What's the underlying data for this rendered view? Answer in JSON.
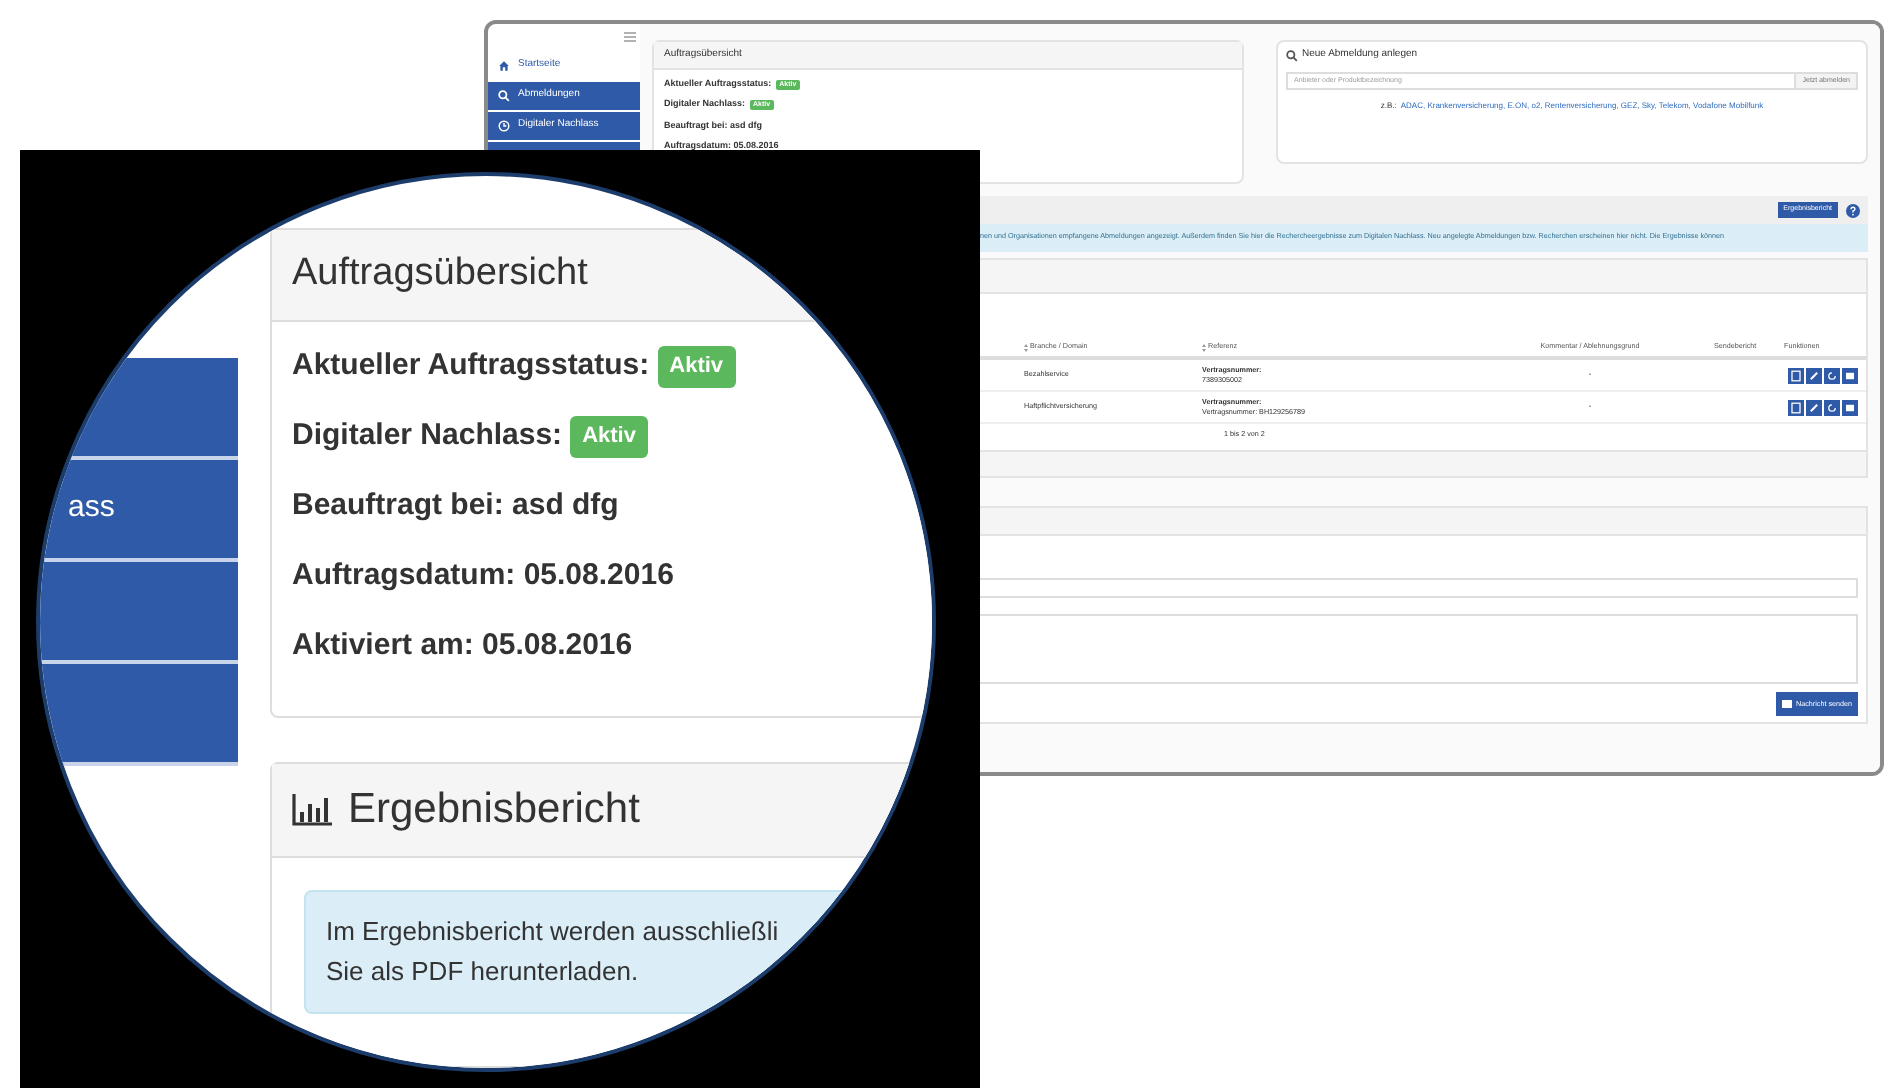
{
  "sidebar": {
    "items": [
      {
        "label": "Startseite",
        "kind": "home",
        "selected": true
      },
      {
        "label": "Abmeldungen",
        "kind": "search",
        "selected": false
      },
      {
        "label": "Digitaler Nachlass",
        "kind": "clock",
        "selected": false
      }
    ]
  },
  "overview": {
    "title": "Auftragsübersicht",
    "fields": [
      {
        "label": "Aktueller Auftragsstatus:",
        "badge": "Aktiv"
      },
      {
        "label": "Digitaler Nachlass:",
        "badge": "Aktiv"
      },
      {
        "label": "Beauftragt bei:",
        "value": "asd dfg"
      },
      {
        "label": "Auftragsdatum:",
        "value": "05.08.2016"
      }
    ]
  },
  "new_cancellation": {
    "title": "Neue Abmeldung anlegen",
    "search": {
      "placeholder": "Anbieter oder Produktbezeichnung"
    },
    "button": "Jetzt abmelden",
    "examples_label": "z.B.:",
    "examples": "ADAC, Krankenversicherung, E.ON, o2, Rentenversicherung, GEZ, Sky, Telekom, Vodafone Mobilfunk"
  },
  "report_button": "Ergebnisbericht",
  "info_text": "nen und Organisationen empfangene Abmeldungen angezeigt. Außerdem finden Sie hier die Rechercheergebnisse zum Digitalen Nachlass. Neu angelegte Abmeldungen bzw. Recherchen erscheinen hier nicht. Die Ergebnisse können",
  "table": {
    "columns": [
      {
        "label": "Branche / Domain",
        "sortable": true
      },
      {
        "label": "Referenz",
        "sortable": true
      },
      {
        "label": "Kommentar / Ablehnungsgrund",
        "sortable": false
      },
      {
        "label": "Sendebericht",
        "sortable": false
      },
      {
        "label": "Funktionen",
        "sortable": false
      }
    ],
    "rows": [
      {
        "branch": "Bezahlservice",
        "reference_label": "Vertragsnummer:",
        "reference_value": "7389305002",
        "comment": "-"
      },
      {
        "branch": "Haftpflichtversicherung",
        "reference_label": "Vertragsnummer:",
        "reference_value": "Vertragsnummer: BH129256789",
        "comment": "-"
      }
    ],
    "pager": "1 bis 2 von 2"
  },
  "send_button": "Nachricht senden",
  "magnifier": {
    "sidebar_label": "ass",
    "overview": {
      "title": "Auftragsübersicht",
      "fields": [
        {
          "label": "Aktueller Auftragsstatus:",
          "badge": "Aktiv"
        },
        {
          "label": "Digitaler Nachlass:",
          "badge": "Aktiv"
        },
        {
          "label": "Beauftragt bei:",
          "value": "asd dfg"
        },
        {
          "label": "Auftragsdatum:",
          "value": "05.08.2016"
        },
        {
          "label": "Aktiviert am:",
          "value": "05.08.2016"
        }
      ]
    },
    "report": {
      "title": "Ergebnisbericht",
      "info_lines": [
        "Im Ergebnisbericht werden ausschließli",
        "Sie als PDF herunterladen."
      ]
    }
  }
}
